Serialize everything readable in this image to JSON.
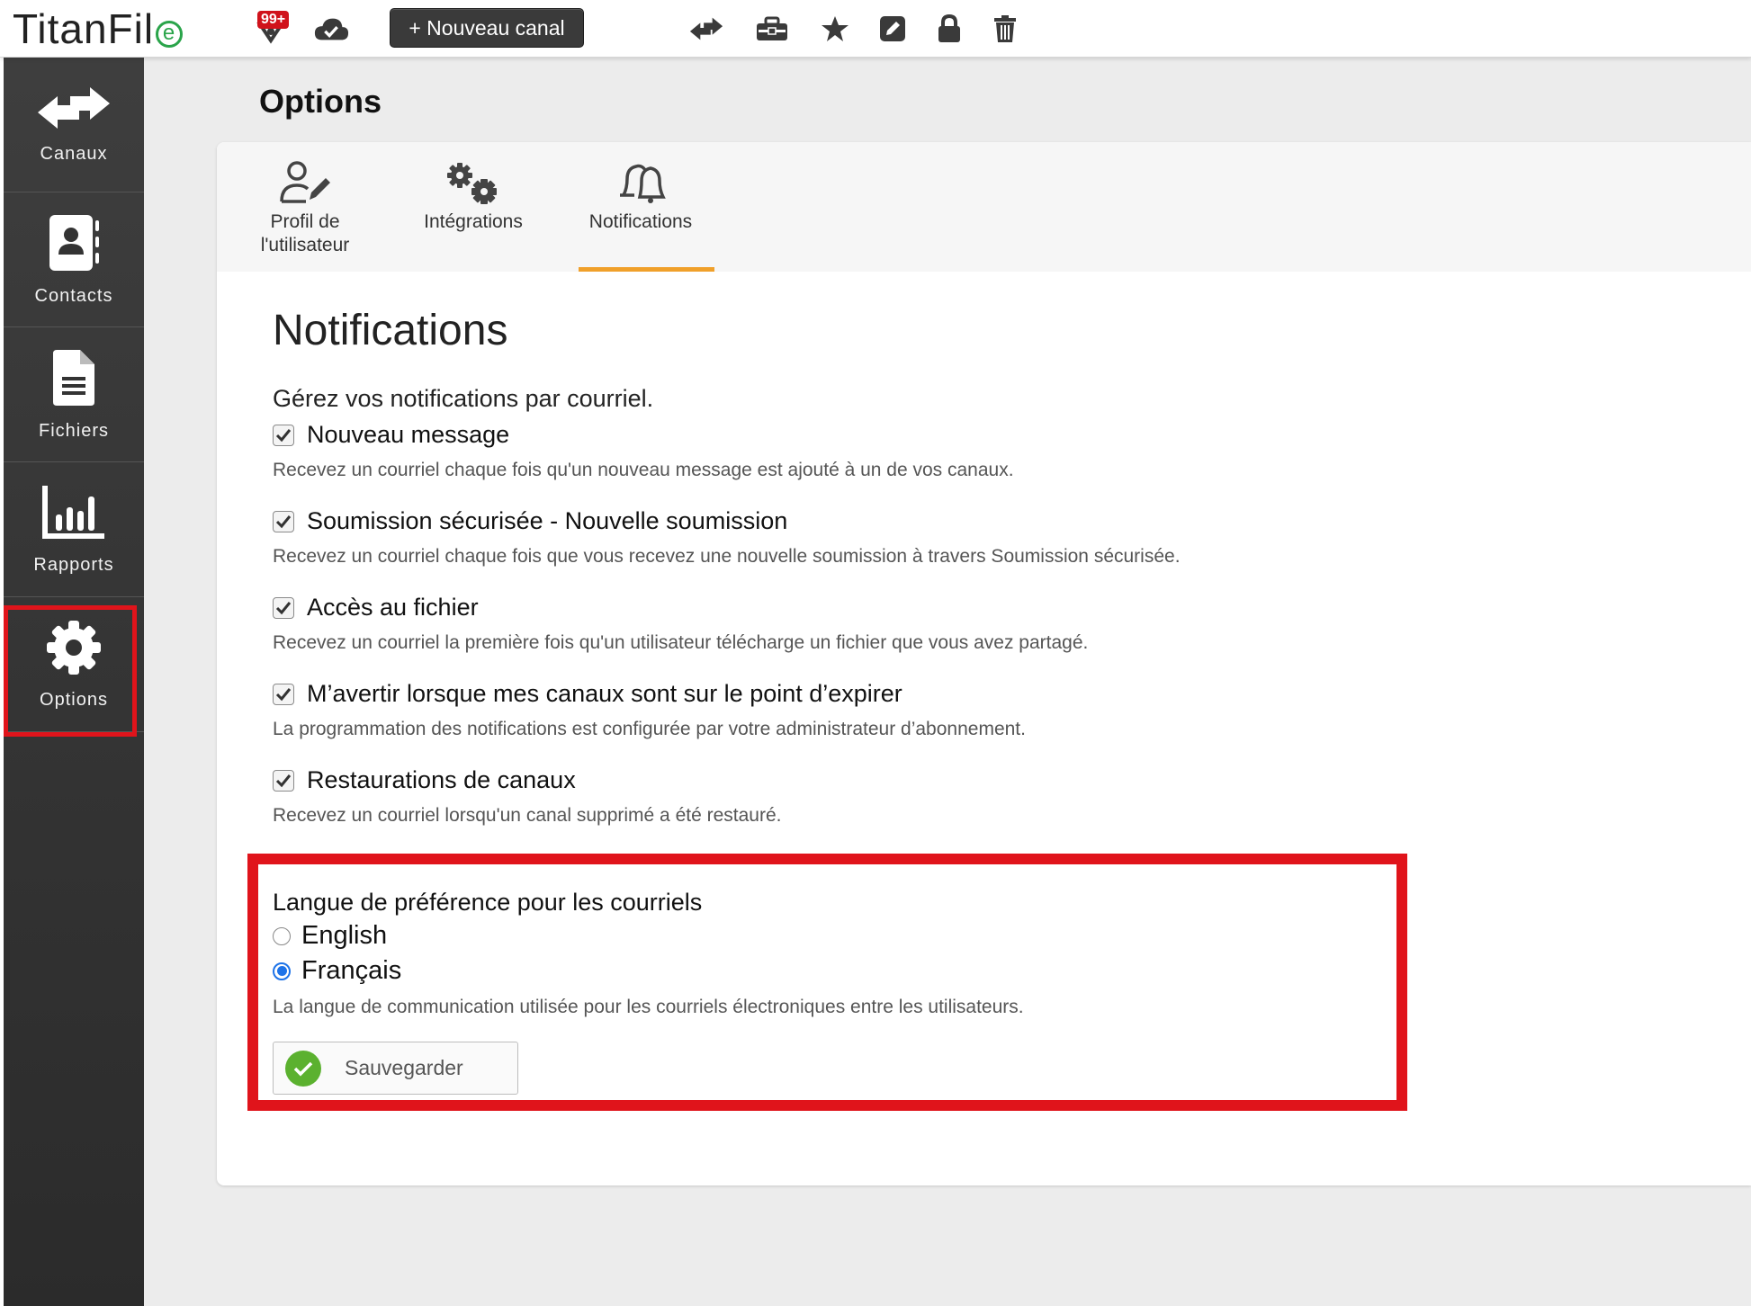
{
  "app": {
    "logo_text": "TitanFil",
    "logo_mark": "e",
    "badge": "99+",
    "new_channel_label": "+ Nouveau canal"
  },
  "toolbar": {
    "icons": [
      "transfer-arrows-icon",
      "toolbox-icon",
      "star-icon",
      "edit-icon",
      "lock-icon",
      "trash-icon"
    ]
  },
  "sidebar": {
    "items": [
      {
        "label": "Canaux",
        "icon": "arrows-icon"
      },
      {
        "label": "Contacts",
        "icon": "contact-book-icon"
      },
      {
        "label": "Fichiers",
        "icon": "file-icon"
      },
      {
        "label": "Rapports",
        "icon": "bar-chart-icon"
      },
      {
        "label": "Options",
        "icon": "gear-icon",
        "selected": true
      }
    ]
  },
  "page": {
    "title": "Options"
  },
  "tabs": [
    {
      "line1": "Profil de",
      "line2": "l'utilisateur",
      "icon": "user-edit-icon"
    },
    {
      "line1": "Intégrations",
      "line2": "",
      "icon": "gears-icon"
    },
    {
      "line1": "Notifications",
      "line2": "",
      "icon": "bells-icon",
      "active": true
    }
  ],
  "notifications": {
    "title": "Notifications",
    "intro": "Gérez vos notifications par courriel.",
    "options": [
      {
        "name": "Nouveau message",
        "desc": "Recevez un courriel chaque fois qu'un nouveau message est ajouté à un de vos canaux.",
        "checked": true
      },
      {
        "name": "Soumission sécurisée - Nouvelle soumission",
        "desc": "Recevez un courriel chaque fois que vous recevez une nouvelle soumission à travers Soumission sécurisée.",
        "checked": true
      },
      {
        "name": "Accès au fichier",
        "desc": "Recevez un courriel la première fois qu'un utilisateur télécharge un fichier que vous avez partagé.",
        "checked": true
      },
      {
        "name": "M’avertir lorsque mes canaux sont sur le point d’expirer",
        "desc": "La programmation des notifications est configurée par votre administrateur d’abonnement.",
        "checked": true
      },
      {
        "name": "Restaurations de canaux",
        "desc": "Recevez un courriel lorsqu'un canal supprimé a été restauré.",
        "checked": true
      }
    ]
  },
  "language": {
    "title": "Langue de préférence pour les courriels",
    "options": [
      {
        "label": "English",
        "selected": false
      },
      {
        "label": "Français",
        "selected": true
      }
    ],
    "desc": "La langue de communication utilisée pour les courriels électroniques entre les utilisateurs.",
    "save_label": "Sauvegarder"
  },
  "colors": {
    "highlight": "#e0141b",
    "tab_underline": "#f0a02a",
    "save_check": "#5bb12f",
    "radio_selected": "#1e73e8"
  }
}
